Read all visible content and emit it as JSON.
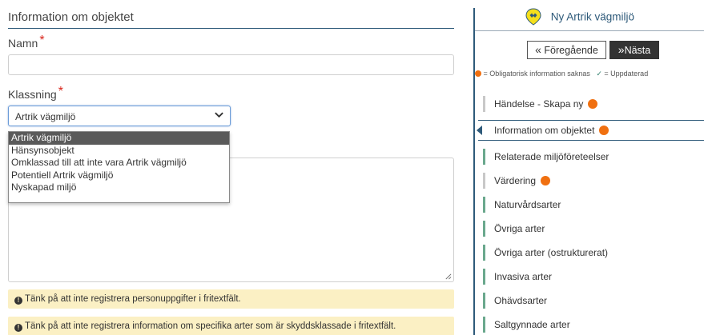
{
  "form": {
    "section_title": "Information om objektet",
    "namn_label": "Namn",
    "required_mark": "*",
    "namn_value": "",
    "klassning_label": "Klassning",
    "klassning_selected": "Artrik vägmiljö",
    "klassning_options": [
      "Artrik vägmiljö",
      "Hänsynsobjekt",
      "Omklassad till att inte vara Artrik vägmiljö",
      "Potentiell Artrik vägmiljö",
      "Nyskapad miljö"
    ],
    "description_value": "",
    "warning_1": "Tänk på att inte registrera personuppgifter i fritextfält.",
    "warning_2": "Tänk på att inte registrera information om specifika arter som är skyddsklassade i fritextfält.",
    "warning_icon": "!"
  },
  "panel": {
    "title": "Ny Artrik vägmiljö",
    "prev_label": "Föregående",
    "next_label": "Nästa",
    "prev_glyph": "«",
    "next_glyph": "»",
    "legend_missing": "= Obligatorisk information saknas",
    "legend_updated": "= Uppdaterad",
    "legend_check": "✓",
    "nav": [
      {
        "label": "Händelse - Skapa ny",
        "missing": true,
        "bar_color": "#c8c8c8",
        "active": false
      },
      {
        "label": "Information om objektet",
        "missing": true,
        "bar_color": "#2e5a7a",
        "active": true
      },
      {
        "label": "Relaterade miljöföreteelser",
        "missing": false,
        "bar_color": "#6aa88d",
        "active": false
      },
      {
        "label": "Värdering",
        "missing": true,
        "bar_color": "#c8c8c8",
        "active": false
      },
      {
        "label": "Naturvårdsarter",
        "missing": false,
        "bar_color": "#6aa88d",
        "active": false
      },
      {
        "label": "Övriga arter",
        "missing": false,
        "bar_color": "#6aa88d",
        "active": false
      },
      {
        "label": "Övriga arter (ostrukturerat)",
        "missing": false,
        "bar_color": "#6aa88d",
        "active": false
      },
      {
        "label": "Invasiva arter",
        "missing": false,
        "bar_color": "#6aa88d",
        "active": false
      },
      {
        "label": "Ohävdsarter",
        "missing": false,
        "bar_color": "#6aa88d",
        "active": false
      },
      {
        "label": "Saltgynnade arter",
        "missing": false,
        "bar_color": "#6aa88d",
        "active": false
      }
    ]
  },
  "colors": {
    "accent": "#2e5a7a",
    "missing_dot": "#f07010",
    "required": "#d9261c",
    "warning_bg": "#fbf0c4",
    "done_bar": "#6aa88d"
  },
  "icons": {
    "logo": "artrik-logo-icon",
    "chevron": "chevron-down-icon",
    "resize": "resize-grip-icon"
  }
}
